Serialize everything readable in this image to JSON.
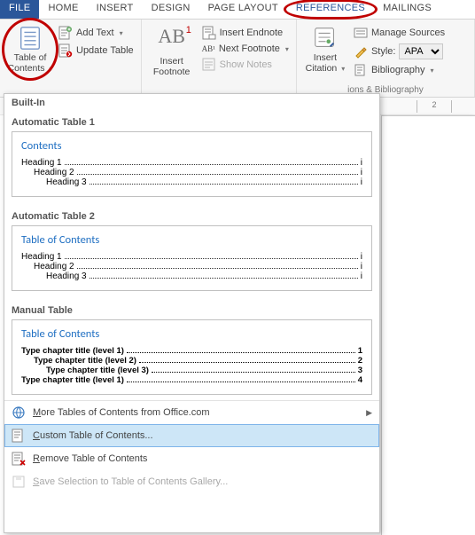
{
  "tabs": {
    "file": "FILE",
    "home": "HOME",
    "insert": "INSERT",
    "design": "DESIGN",
    "layout": "PAGE LAYOUT",
    "references": "REFERENCES",
    "mailings": "MAILINGS"
  },
  "ribbon": {
    "toc": {
      "label1": "Table of",
      "label2": "Contents"
    },
    "add_text": "Add Text",
    "update_table": "Update Table",
    "insert_footnote": {
      "label1": "Insert",
      "label2": "Footnote"
    },
    "insert_endnote": "Insert Endnote",
    "next_footnote": "Next Footnote",
    "show_notes": "Show Notes",
    "insert_citation": {
      "label1": "Insert",
      "label2": "Citation"
    },
    "manage_sources": "Manage Sources",
    "style_label": "Style:",
    "style_value": "APA",
    "bibliography": "Bibliography",
    "group_label": "ions & Bibliography"
  },
  "ruler": {
    "tick": "2"
  },
  "dropdown": {
    "builtin": "Built-In",
    "auto1": {
      "header": "Automatic Table 1",
      "title": "Contents",
      "rows": [
        {
          "level": 1,
          "text": "Heading 1",
          "page": "i"
        },
        {
          "level": 2,
          "text": "Heading 2",
          "page": "i"
        },
        {
          "level": 3,
          "text": "Heading 3",
          "page": "i"
        }
      ]
    },
    "auto2": {
      "header": "Automatic Table 2",
      "title": "Table of Contents",
      "rows": [
        {
          "level": 1,
          "text": "Heading 1",
          "page": "i"
        },
        {
          "level": 2,
          "text": "Heading 2",
          "page": "i"
        },
        {
          "level": 3,
          "text": "Heading 3",
          "page": "i"
        }
      ]
    },
    "manual": {
      "header": "Manual Table",
      "title": "Table of Contents",
      "rows": [
        {
          "level": 1,
          "text": "Type chapter title (level 1)",
          "page": "1"
        },
        {
          "level": 2,
          "text": "Type chapter title (level 2)",
          "page": "2"
        },
        {
          "level": 3,
          "text": "Type chapter title (level 3)",
          "page": "3"
        },
        {
          "level": 1,
          "text": "Type chapter title (level 1)",
          "page": "4"
        }
      ]
    },
    "menu": {
      "more": "More Tables of Contents from Office.com",
      "custom": "Custom Table of Contents...",
      "remove": "Remove Table of Contents",
      "save": "Save Selection to Table of Contents Gallery..."
    }
  }
}
